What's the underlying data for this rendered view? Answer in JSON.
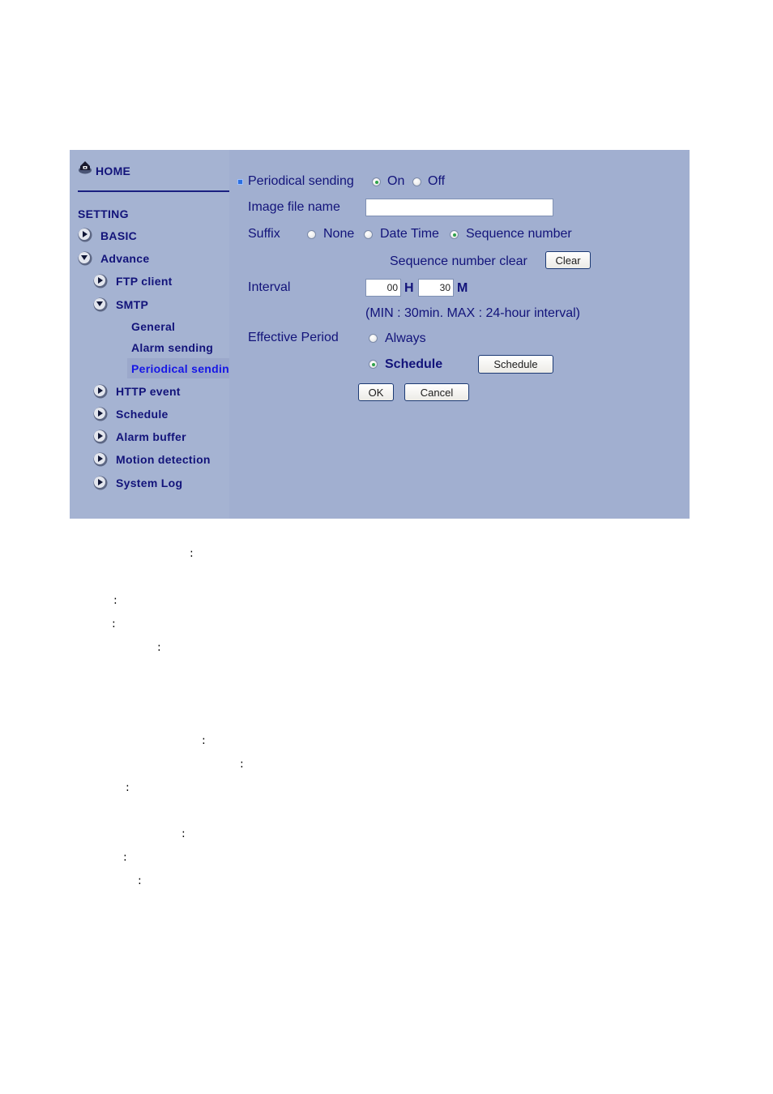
{
  "sidebar": {
    "home_label": "HOME",
    "setting_label": "SETTING",
    "items": [
      {
        "label": "BASIC",
        "icon": "arrow-right-icon",
        "expanded": false,
        "level": 0
      },
      {
        "label": "Advance",
        "icon": "arrow-down-icon",
        "expanded": true,
        "level": 0
      },
      {
        "label": "FTP client",
        "icon": "arrow-right-icon",
        "expanded": false,
        "level": 1
      },
      {
        "label": "SMTP",
        "icon": "arrow-down-icon",
        "expanded": true,
        "level": 1
      },
      {
        "label": "General",
        "level": 2
      },
      {
        "label": "Alarm sending",
        "level": 2
      },
      {
        "label": "Periodical sending",
        "level": 2,
        "selected": true
      },
      {
        "label": "HTTP event",
        "icon": "arrow-right-icon",
        "expanded": false,
        "level": 1
      },
      {
        "label": "Schedule",
        "icon": "arrow-right-icon",
        "expanded": false,
        "level": 1
      },
      {
        "label": "Alarm buffer",
        "icon": "arrow-right-icon",
        "expanded": false,
        "level": 1
      },
      {
        "label": "Motion detection",
        "icon": "arrow-right-icon",
        "expanded": false,
        "level": 1
      },
      {
        "label": "System Log",
        "icon": "arrow-right-icon",
        "expanded": false,
        "level": 1
      }
    ]
  },
  "form": {
    "periodical_sending": {
      "label": "Periodical sending",
      "options": [
        "On",
        "Off"
      ],
      "selected": "On"
    },
    "image_file_name": {
      "label": "Image file name",
      "value": ""
    },
    "suffix": {
      "label": "Suffix",
      "options": [
        "None",
        "Date Time",
        "Sequence number"
      ],
      "selected": "Sequence number"
    },
    "sequence_clear": {
      "label": "Sequence number clear",
      "button": "Clear"
    },
    "interval": {
      "label": "Interval",
      "hours": "00",
      "hours_unit": "H",
      "minutes": "30",
      "minutes_unit": "M",
      "note": "(MIN : 30min. MAX : 24-hour interval)"
    },
    "effective_period": {
      "label": "Effective Period",
      "options": [
        "Always",
        "Schedule"
      ],
      "selected": "Schedule",
      "schedule_button": "Schedule"
    },
    "ok_button": "OK",
    "cancel_button": "Cancel"
  },
  "doc_colons": [
    ":",
    ":",
    ":",
    ":",
    ":",
    ":",
    ":",
    ":",
    ":",
    ":"
  ],
  "colors": {
    "panel_bg": "#a1afd0",
    "nav_text": "#12137a",
    "selected_text": "#1616e6",
    "radio_dot": "#2fa24a"
  }
}
